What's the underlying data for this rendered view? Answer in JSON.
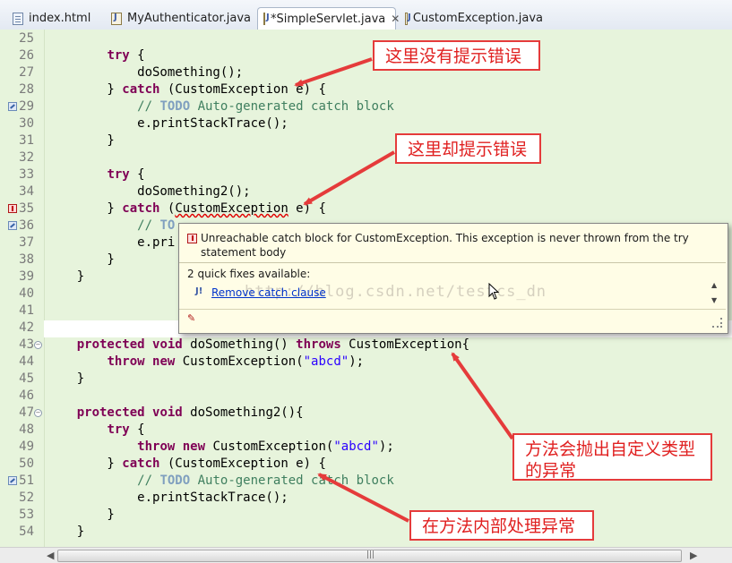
{
  "tabs": [
    {
      "label": "index.html",
      "icon": "html-file-icon"
    },
    {
      "label": "MyAuthenticator.java",
      "icon": "java-file-icon"
    },
    {
      "label": "*SimpleServlet.java",
      "icon": "java-file-icon",
      "close": "✕"
    },
    {
      "label": "CustomException.java",
      "icon": "java-file-icon"
    }
  ],
  "editor": {
    "line_numbers": [
      "25",
      "26",
      "27",
      "28",
      "29",
      "30",
      "31",
      "32",
      "33",
      "34",
      "35",
      "36",
      "37",
      "38",
      "39",
      "40",
      "41",
      "42",
      "43",
      "44",
      "45",
      "46",
      "47",
      "48",
      "49",
      "50",
      "51",
      "52",
      "53",
      "54"
    ]
  },
  "popup": {
    "message": "Unreachable catch block for CustomException. This exception is never thrown from the try statement body",
    "fixes_header": "2 quick fixes available:",
    "fix_label": "Remove catch clause",
    "watermark": "http://blog.csdn.net/testcs_dn"
  },
  "annotations": {
    "no_error": "这里没有提示错误",
    "has_error": "这里却提示错误",
    "throws_custom_line1": "方法会抛出自定义类型",
    "throws_custom_line2": "的异常",
    "handled_inside": "在方法内部处理异常"
  },
  "colors": {
    "editor_bg": "#e7f4dc",
    "keyword": "#7f0055",
    "comment": "#3f7f5f",
    "string": "#2a00ff",
    "annotation_red": "#e53b3b"
  }
}
